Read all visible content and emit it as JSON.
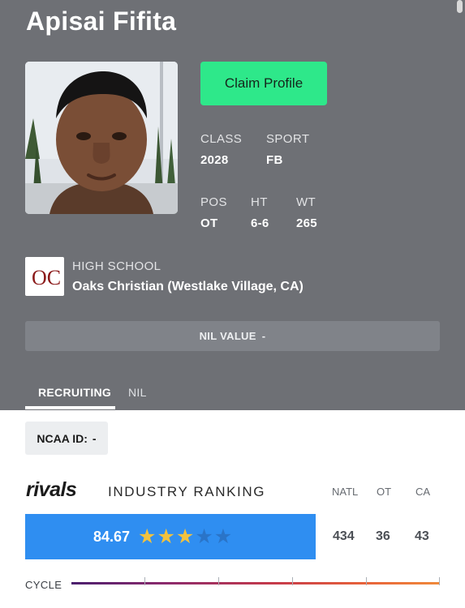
{
  "player": {
    "name": "Apisai Fifita"
  },
  "actions": {
    "claim_label": "Claim Profile"
  },
  "stats": {
    "class_label": "CLASS",
    "class_value": "2028",
    "sport_label": "SPORT",
    "sport_value": "FB",
    "pos_label": "POS",
    "pos_value": "OT",
    "ht_label": "HT",
    "ht_value": "6-6",
    "wt_label": "WT",
    "wt_value": "265"
  },
  "school": {
    "label": "HIGH SCHOOL",
    "name": "Oaks Christian (Westlake Village, CA)",
    "logo_text": "OC"
  },
  "nil": {
    "label": "NIL VALUE",
    "value": "-"
  },
  "tabs": [
    {
      "label": "RECRUITING",
      "active": true
    },
    {
      "label": "NIL",
      "active": false
    }
  ],
  "ncaa": {
    "label": "NCAA ID:",
    "value": "-"
  },
  "ranking": {
    "brand": "rivals",
    "title": "INDUSTRY RANKING",
    "rating": "84.67",
    "stars_filled": 3,
    "stars_total": 5,
    "columns": [
      {
        "label": "NATL",
        "value": "434"
      },
      {
        "label": "OT",
        "value": "36"
      },
      {
        "label": "CA",
        "value": "43"
      }
    ]
  },
  "cycle": {
    "label": "CYCLE"
  },
  "colors": {
    "header_bg": "#6e7075",
    "claim_green": "#2ee88a",
    "rating_blue": "#2f8ef1",
    "star_gold": "#f2c23e",
    "school_red": "#8b1a1a"
  },
  "icons": {
    "star": "star-icon",
    "school_logo": "oaks-christian-logo"
  }
}
